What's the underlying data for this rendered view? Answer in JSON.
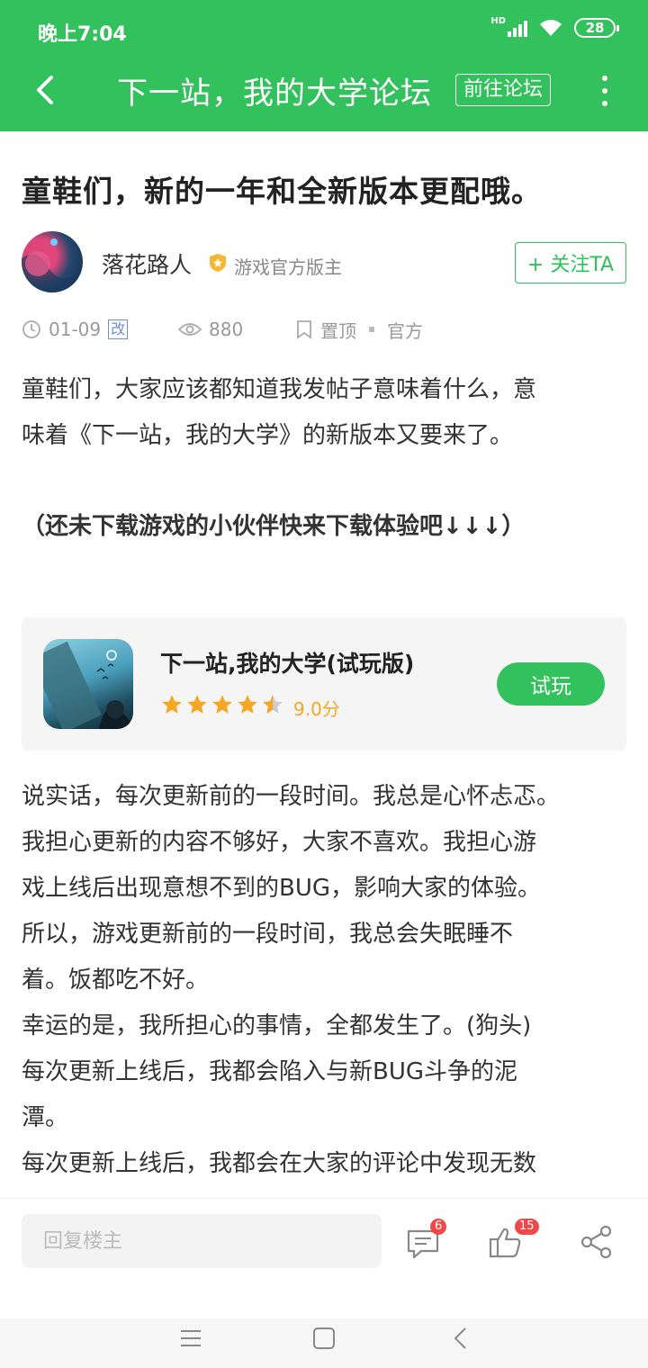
{
  "status_bar": {
    "time": "晚上7:04",
    "network": "HD",
    "battery": "28"
  },
  "nav": {
    "title": "下一站，我的大学论坛",
    "forum_button": "前往论坛"
  },
  "post": {
    "title": "童鞋们，新的一年和全新版本更配哦。",
    "author": {
      "name": "落花路人",
      "role": "游戏官方版主",
      "follow_label": "+ 关注TA"
    },
    "meta": {
      "date": "01-09",
      "edited_tag": "改",
      "views": "880",
      "pinned": "置顶",
      "official": "官方"
    },
    "paragraph_1_line_1": "童鞋们，大家应该都知道我发帖子意味着什么，意",
    "paragraph_1_line_2": "味着《下一站，我的大学》的新版本又要来了。",
    "paragraph_2": "（还未下载游戏的小伙伴快来下载体验吧↓↓↓）",
    "body_lines": [
      "说实话，每次更新前的一段时间。我总是心怀忐忑。",
      "我担心更新的内容不够好，大家不喜欢。我担心游",
      "戏上线后出现意想不到的BUG，影响大家的体验。",
      "所以，游戏更新前的一段时间，我总会失眠睡不",
      "着。饭都吃不好。",
      "幸运的是，我所担心的事情，全都发生了。(狗头)",
      "每次更新上线后，我都会陷入与新BUG斗争的泥",
      "潭。",
      "每次更新上线后，我都会在大家的评论中发现无数"
    ]
  },
  "game_card": {
    "name": "下一站,我的大学(试玩版)",
    "rating": 4.5,
    "score": "9.0分",
    "play_label": "试玩"
  },
  "bottom_bar": {
    "reply_placeholder": "回复楼主",
    "comment_count": "6",
    "like_count": "15"
  },
  "colors": {
    "primary": "#32c15c",
    "star": "#f5a623",
    "badge": "#f04848"
  }
}
